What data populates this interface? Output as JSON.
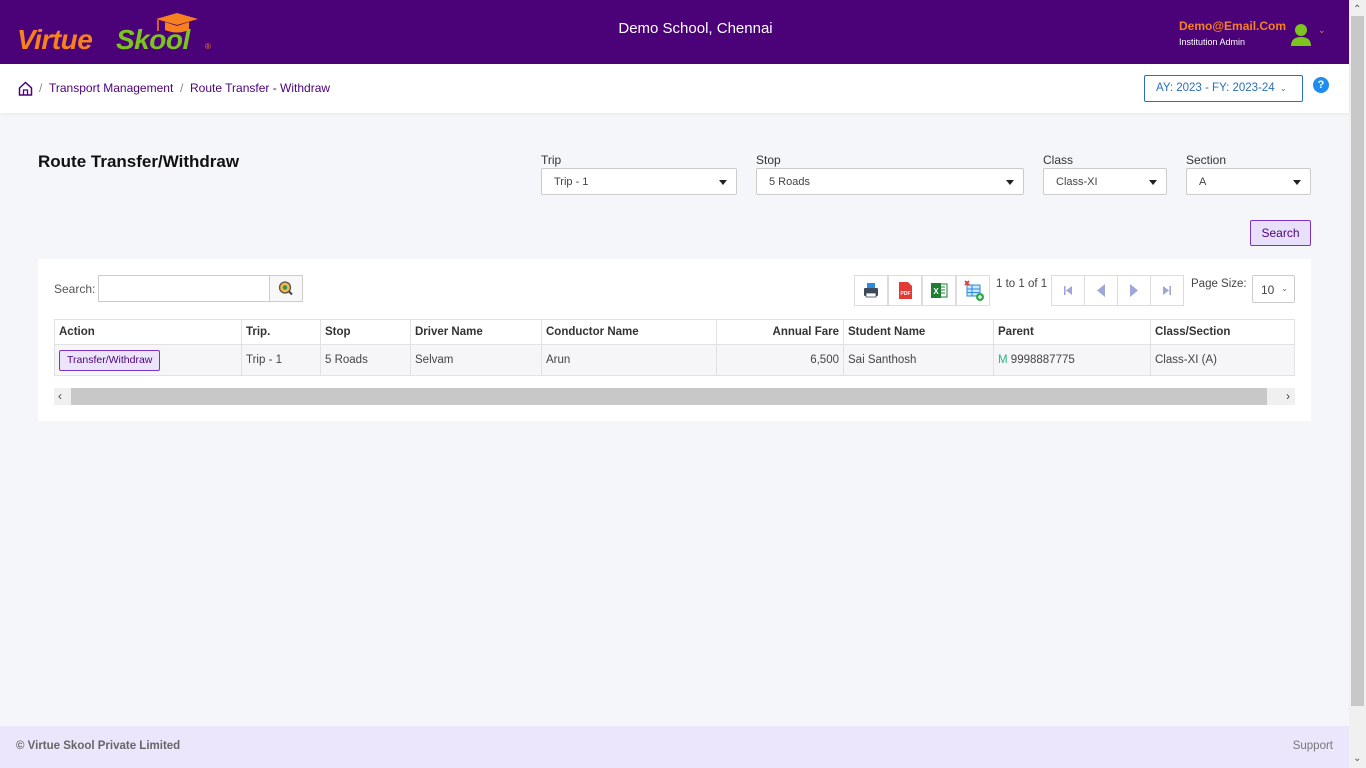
{
  "header": {
    "logo_part1": "Virtue",
    "logo_part2": "Skool",
    "logo_reg": "®",
    "school_name": "Demo School, Chennai",
    "user_email": "Demo@Email.Com",
    "user_role": "Institution Admin",
    "colors": {
      "bar": "#4b0279",
      "orange": "#f7811f",
      "green": "#7cc41e"
    }
  },
  "breadcrumb": {
    "items": [
      "Transport Management",
      "Route Transfer - Withdraw"
    ],
    "separator": "/"
  },
  "year_selector": {
    "label": "AY: 2023 - FY: 2023-24"
  },
  "page": {
    "title": "Route Transfer/Withdraw"
  },
  "filters": {
    "trip": {
      "label": "Trip",
      "value": "Trip - 1"
    },
    "stop": {
      "label": "Stop",
      "value": "5 Roads"
    },
    "class": {
      "label": "Class",
      "value": "Class-XI"
    },
    "section": {
      "label": "Section",
      "value": "A"
    },
    "search_button": "Search"
  },
  "grid": {
    "search_label": "Search:",
    "search_value": "",
    "page_info": "1 to 1 of 1",
    "page_size_label": "Page Size:",
    "page_size": "10",
    "columns": [
      "Action",
      "Trip.",
      "Stop",
      "Driver Name",
      "Conductor Name",
      "Annual Fare",
      "Student Name",
      "Parent",
      "Class/Section"
    ],
    "rows": [
      {
        "action": "Transfer/Withdraw",
        "trip": "Trip - 1",
        "stop": "5 Roads",
        "driver": "Selvam",
        "conductor": "Arun",
        "fare": "6,500",
        "student": "Sai Santhosh",
        "parent_tag": "M",
        "parent_phone": "9998887775",
        "class_section": "Class-XI (A)"
      }
    ]
  },
  "footer": {
    "copyright": "© Virtue Skool Private Limited",
    "support": "Support"
  }
}
